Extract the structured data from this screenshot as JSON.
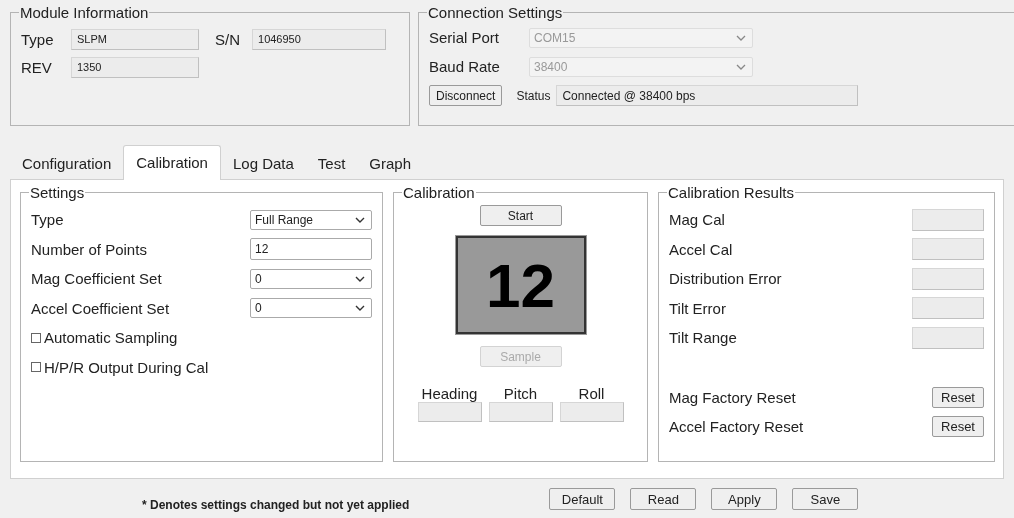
{
  "module_information": {
    "title": "Module Information",
    "type": {
      "label": "Type",
      "value": "SLPM"
    },
    "serial_number": {
      "label": "S/N",
      "value": "1046950"
    },
    "rev": {
      "label": "REV",
      "value": "1350"
    }
  },
  "connection_settings": {
    "title": "Connection Settings",
    "serial_port": {
      "label": "Serial Port",
      "value": "COM15",
      "disabled": true
    },
    "baud_rate": {
      "label": "Baud Rate",
      "value": "38400",
      "disabled": true
    },
    "disconnect_button": "Disconnect",
    "status": {
      "label": "Status",
      "value": "Connected @ 38400 bps"
    }
  },
  "tabs": [
    {
      "label": "Configuration",
      "selected": false
    },
    {
      "label": "Calibration",
      "selected": true
    },
    {
      "label": "Log Data",
      "selected": false
    },
    {
      "label": "Test",
      "selected": false
    },
    {
      "label": "Graph",
      "selected": false
    }
  ],
  "settings": {
    "title": "Settings",
    "rows": [
      {
        "kind": "select",
        "label": "Type",
        "value": "Full Range"
      },
      {
        "kind": "input",
        "label": "Number of Points",
        "value": "12"
      },
      {
        "kind": "select",
        "label": "Mag Coefficient Set",
        "value": "0"
      },
      {
        "kind": "select",
        "label": "Accel Coefficient Set",
        "value": "0"
      },
      {
        "kind": "checkbox",
        "label": "Automatic Sampling",
        "checked": false
      },
      {
        "kind": "checkbox",
        "label": "H/P/R Output During Cal",
        "checked": false
      }
    ]
  },
  "calibration": {
    "title": "Calibration",
    "start_button": {
      "label": "Start",
      "disabled": false
    },
    "count": "12",
    "sample_button": {
      "label": "Sample",
      "disabled": true
    },
    "readouts": [
      {
        "label": "Heading"
      },
      {
        "label": "Pitch"
      },
      {
        "label": "Roll"
      }
    ]
  },
  "calibration_results": {
    "title": "Calibration Results",
    "rows": [
      {
        "kind": "value",
        "label": "Mag Cal"
      },
      {
        "kind": "value",
        "label": "Accel Cal"
      },
      {
        "kind": "value",
        "label": "Distribution Error"
      },
      {
        "kind": "value",
        "label": "Tilt Error"
      },
      {
        "kind": "value",
        "label": "Tilt Range"
      },
      {
        "kind": "reset",
        "label": "Mag Factory Reset",
        "button": "Reset"
      },
      {
        "kind": "reset",
        "label": "Accel Factory Reset",
        "button": "Reset"
      }
    ]
  },
  "footer": {
    "note": "* Denotes settings changed but not yet applied",
    "buttons": [
      "Default",
      "Read",
      "Apply",
      "Save"
    ]
  }
}
